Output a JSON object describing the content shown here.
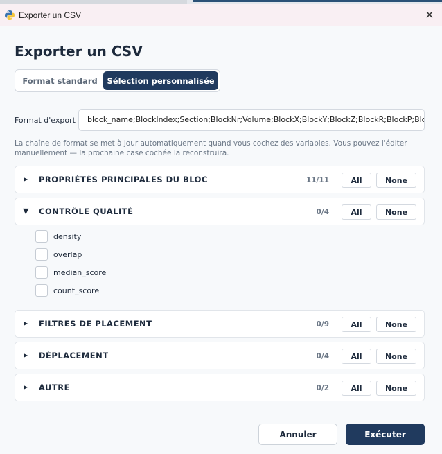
{
  "window": {
    "title": "Exporter un CSV",
    "close_icon": "close-icon",
    "app_icon": "python-icon"
  },
  "dialog": {
    "heading": "Exporter un CSV",
    "tabs": [
      {
        "label": "Format standard",
        "selected": false
      },
      {
        "label": "Sélection personnalisée",
        "selected": true
      }
    ],
    "format_label": "Format d'export",
    "format_value": "block_name;BlockIndex;Section;BlockNr;Volume;BlockX;BlockY;BlockZ;BlockR;BlockP;BlockH",
    "help_text": "La chaîne de format se met à jour automatiquement quand vous cochez des variables. Vous pouvez l'éditer manuellement — la prochaine case cochée la reconstruira."
  },
  "groups": [
    {
      "title": "PROPRIÉTÉS PRINCIPALES DU BLOC",
      "count": "11/11",
      "expanded": false,
      "all_label": "All",
      "none_label": "None"
    },
    {
      "title": "CONTRÔLE QUALITÉ",
      "count": "0/4",
      "expanded": true,
      "all_label": "All",
      "none_label": "None",
      "items": [
        {
          "label": "density",
          "checked": false
        },
        {
          "label": "overlap",
          "checked": false
        },
        {
          "label": "median_score",
          "checked": false
        },
        {
          "label": "count_score",
          "checked": false
        }
      ]
    },
    {
      "title": "FILTRES DE PLACEMENT",
      "count": "0/9",
      "expanded": false,
      "all_label": "All",
      "none_label": "None"
    },
    {
      "title": "DÉPLACEMENT",
      "count": "0/4",
      "expanded": false,
      "all_label": "All",
      "none_label": "None"
    },
    {
      "title": "AUTRE",
      "count": "0/2",
      "expanded": false,
      "all_label": "All",
      "none_label": "None"
    }
  ],
  "footer": {
    "cancel_label": "Annuler",
    "execute_label": "Exécuter"
  },
  "colors": {
    "primary": "#203a5e",
    "background": "#f7f9fb",
    "titlebar": "#f9eff3"
  }
}
